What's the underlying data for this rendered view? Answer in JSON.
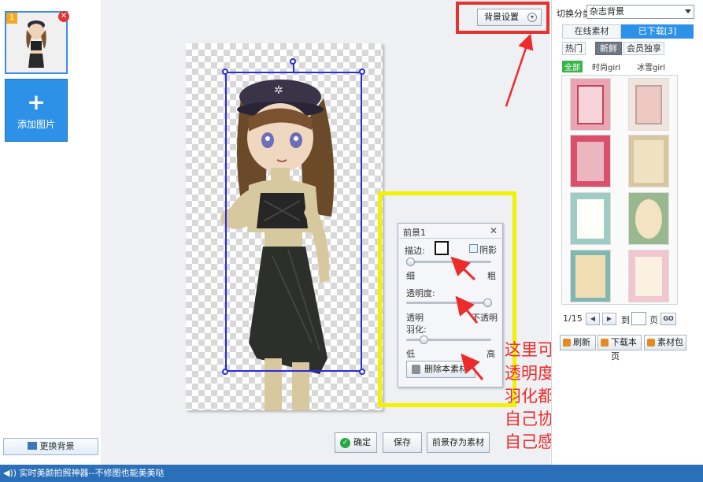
{
  "left_panel": {
    "thumb_number": "1",
    "thumb_close": "✕",
    "add_plus": "+",
    "add_label": "添加图片",
    "change_bg_label": "更换背景"
  },
  "toolbar": {
    "bg_settings_label": "背景设置",
    "bg_settings_chevron": "▾"
  },
  "fg_panel": {
    "title": "前景1",
    "close": "✕",
    "stroke_label": "描边:",
    "shadow_label": "阴影",
    "thin_label": "细",
    "thick_label": "粗",
    "opacity_label": "透明度:",
    "transparent_label": "透明",
    "opaque_label": "不透明",
    "feather_label": "羽化:",
    "low_label": "低",
    "high_label": "高",
    "delete_label": "删除本素材",
    "stroke_level": 0.05,
    "opacity_level": 0.95,
    "feather_level": 0.2
  },
  "bottom_buttons": {
    "confirm_label": "确定",
    "confirm_icon": "✓",
    "save_label": "保存",
    "save_fg_label": "前景存为素材"
  },
  "annotations": [
    "这里可以描边",
    "透明度",
    "羽化都可以选择",
    "自己协调",
    "自己感觉美观为止"
  ],
  "right_panel": {
    "category_label": "切换分类",
    "category_value": "杂志背景",
    "tab_online": "在线素材",
    "tab_downloaded": "已下载[3]",
    "sub_tabs": [
      "热门",
      "新鲜",
      "会员独享"
    ],
    "filters": [
      "全部",
      "时尚girl",
      "冰雪girl"
    ],
    "page_info": "1/15",
    "prev_icon": "◀",
    "next_icon": "▶",
    "goto_label": "到",
    "page_unit": "页",
    "go_label": "GO",
    "refresh_label": "刷新",
    "download_page_label": "下载本页",
    "material_bag_label": "素材包"
  },
  "status_bar": {
    "text": "◀)) 实时美颜拍照神器--不修图也能美美哒"
  },
  "colors": {
    "accent_blue": "#2e91e8",
    "annotation_red": "#ee2b2b",
    "highlight_yellow": "#f2f200",
    "selection_blue": "#2b2bd8"
  }
}
